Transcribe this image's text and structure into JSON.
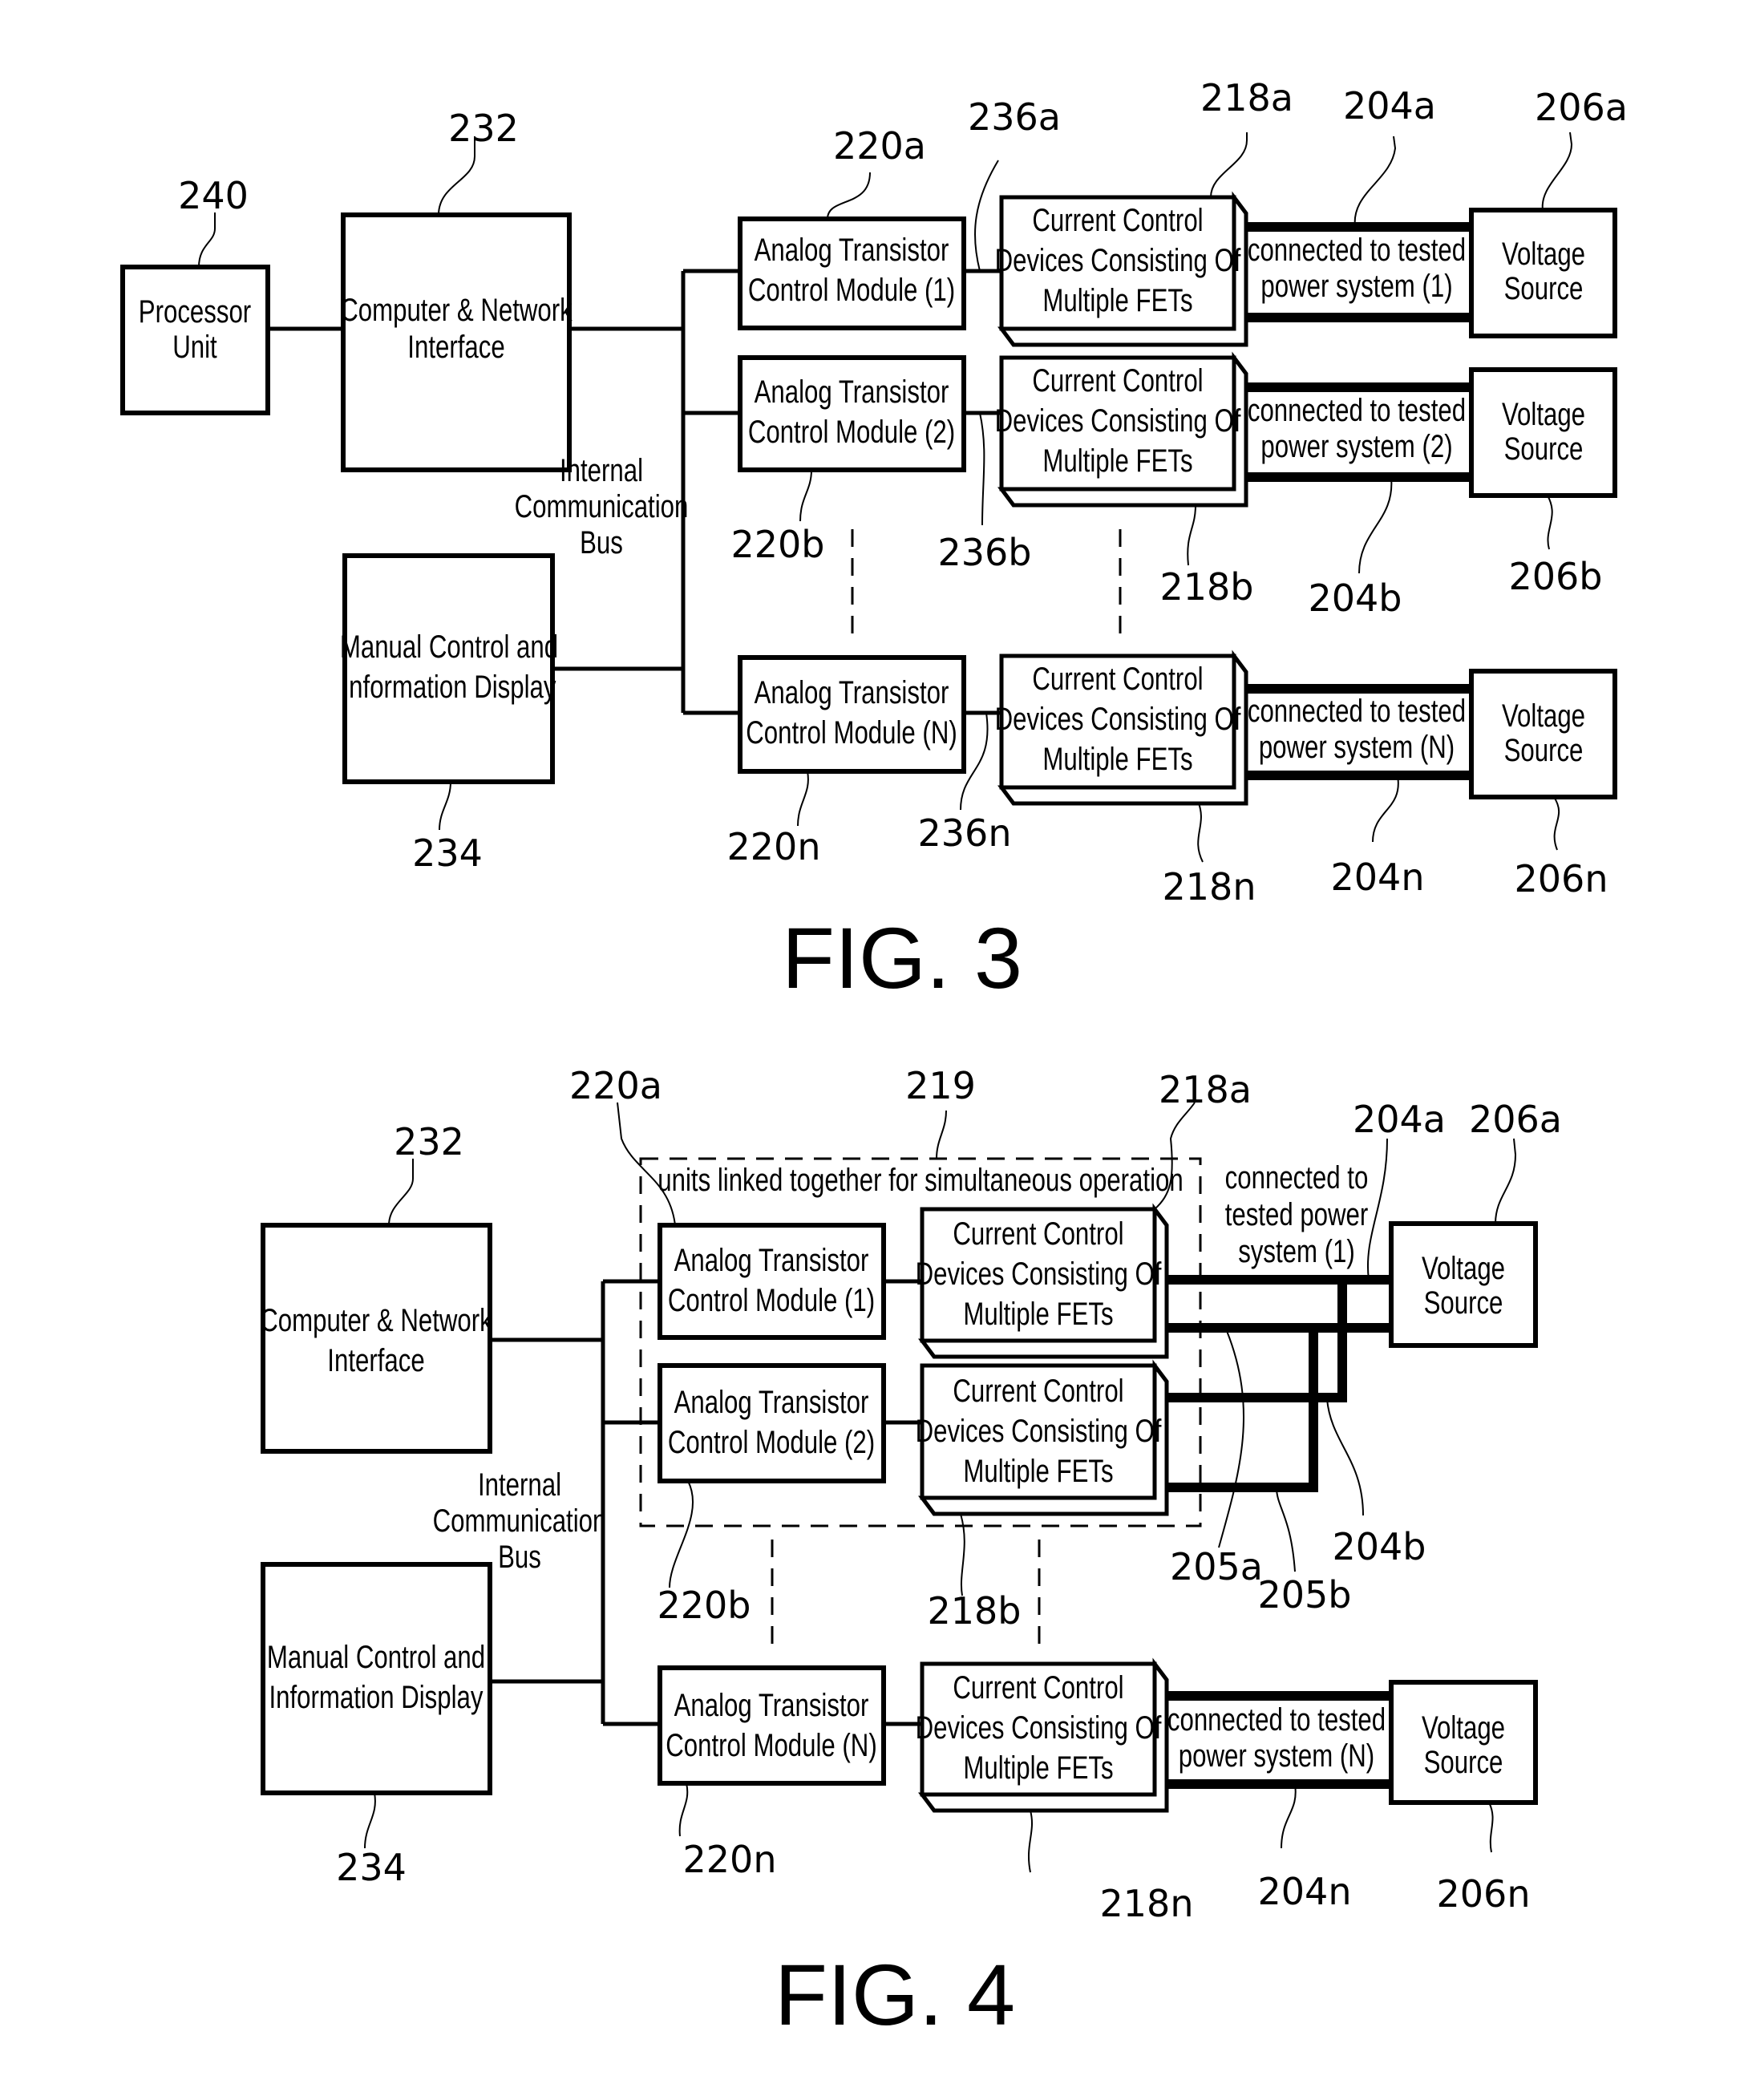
{
  "fig3": {
    "caption": "FIG. 3",
    "processor": {
      "lines": [
        "Processor",
        "Unit"
      ],
      "ref": "240"
    },
    "computer": {
      "lines": [
        "Computer & Network",
        "Interface"
      ],
      "ref": "232"
    },
    "manual": {
      "lines": [
        "Manual Control and",
        "Information Display"
      ],
      "ref": "234"
    },
    "bus": {
      "lines": [
        "Internal",
        "Communication",
        "Bus"
      ]
    },
    "rows": [
      {
        "module": [
          "Analog Transistor",
          "Control Module (1)"
        ],
        "module_ref": "220a",
        "link_ref": "236a",
        "fet": [
          "Current Control",
          "Devices Consisting Of",
          "Multiple FETs"
        ],
        "fet_ref": "218a",
        "conn": [
          "connected to tested",
          "power system (1)"
        ],
        "conn_ref": "204a",
        "source": [
          "Voltage",
          "Source"
        ],
        "source_ref": "206a"
      },
      {
        "module": [
          "Analog Transistor",
          "Control Module (2)"
        ],
        "module_ref": "220b",
        "link_ref": "236b",
        "fet": [
          "Current Control",
          "Devices Consisting Of",
          "Multiple FETs"
        ],
        "fet_ref": "218b",
        "conn": [
          "connected to tested",
          "power system (2)"
        ],
        "conn_ref": "204b",
        "source": [
          "Voltage",
          "Source"
        ],
        "source_ref": "206b"
      },
      {
        "module": [
          "Analog Transistor",
          "Control Module (N)"
        ],
        "module_ref": "220n",
        "link_ref": "236n",
        "fet": [
          "Current Control",
          "Devices Consisting Of",
          "Multiple FETs"
        ],
        "fet_ref": "218n",
        "conn": [
          "connected to tested",
          "power system (N)"
        ],
        "conn_ref": "204n",
        "source": [
          "Voltage",
          "Source"
        ],
        "source_ref": "206n"
      }
    ]
  },
  "fig4": {
    "caption": "FIG. 4",
    "computer": {
      "lines": [
        "Computer & Network",
        "Interface"
      ],
      "ref": "232"
    },
    "manual": {
      "lines": [
        "Manual Control and",
        "Information Display"
      ],
      "ref": "234"
    },
    "bus": {
      "lines": [
        "Internal",
        "Communication",
        "Bus"
      ]
    },
    "group": {
      "label": "units linked together for simultaneous operation",
      "ref": "219"
    },
    "shared_conn": {
      "lines": [
        "connected to",
        "tested power",
        "system (1)"
      ]
    },
    "shared_refs": {
      "conn_a": "204a",
      "conn_b": "204b",
      "bridge_a": "205a",
      "bridge_b": "205b"
    },
    "rows": [
      {
        "module": [
          "Analog Transistor",
          "Control Module (1)"
        ],
        "module_ref": "220a",
        "fet": [
          "Current Control",
          "Devices Consisting Of",
          "Multiple FETs"
        ],
        "fet_ref": "218a",
        "source": [
          "Voltage",
          "Source"
        ],
        "source_ref": "206a"
      },
      {
        "module": [
          "Analog Transistor",
          "Control Module (2)"
        ],
        "module_ref": "220b",
        "fet": [
          "Current Control",
          "Devices Consisting Of",
          "Multiple FETs"
        ],
        "fet_ref": "218b"
      },
      {
        "module": [
          "Analog Transistor",
          "Control Module (N)"
        ],
        "module_ref": "220n",
        "fet": [
          "Current Control",
          "Devices Consisting Of",
          "Multiple FETs"
        ],
        "fet_ref": "218n",
        "conn": [
          "connected to tested",
          "power system (N)"
        ],
        "conn_ref": "204n",
        "source": [
          "Voltage",
          "Source"
        ],
        "source_ref": "206n"
      }
    ]
  }
}
